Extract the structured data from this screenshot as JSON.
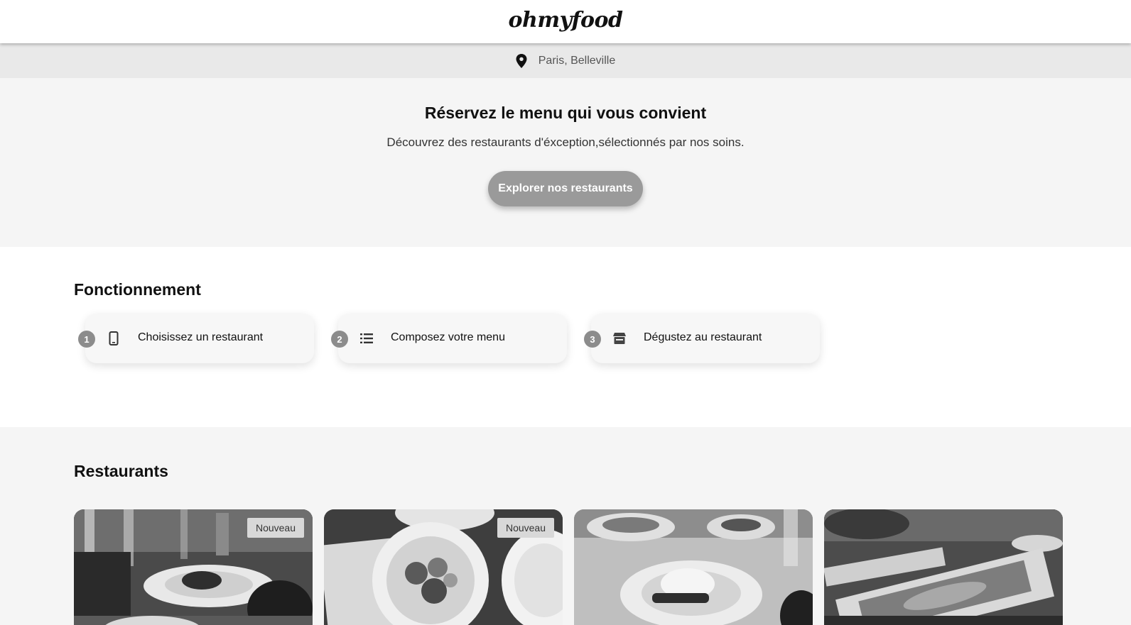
{
  "header": {
    "logo": "ohmyfood"
  },
  "location": {
    "icon": "map-pin-icon",
    "text": "Paris, Belleville"
  },
  "hero": {
    "title": "Réservez le menu qui vous convient",
    "subtitle": "Découvrez des restaurants d'éxception,sélectionnés par nos soins.",
    "cta_label": "Explorer nos restaurants"
  },
  "how": {
    "title": "Fonctionnement",
    "steps": [
      {
        "number": "1",
        "icon": "smartphone-icon",
        "label": "Choisissez un restaurant"
      },
      {
        "number": "2",
        "icon": "list-icon",
        "label": "Composez votre menu"
      },
      {
        "number": "3",
        "icon": "store-icon",
        "label": "Dégustez au restaurant"
      }
    ]
  },
  "restaurants": {
    "title": "Restaurants",
    "cards": [
      {
        "badge": "Nouveau"
      },
      {
        "badge": "Nouveau"
      },
      {
        "badge": ""
      },
      {
        "badge": ""
      }
    ]
  },
  "colors": {
    "header_bg": "#ffffff",
    "location_bg": "#e9e9e9",
    "hero_bg": "#f5f5f5",
    "cta_bg": "#9a9a9a",
    "step_number_bg": "#8c8c8c",
    "badge_bg": "#d8d8d8"
  }
}
